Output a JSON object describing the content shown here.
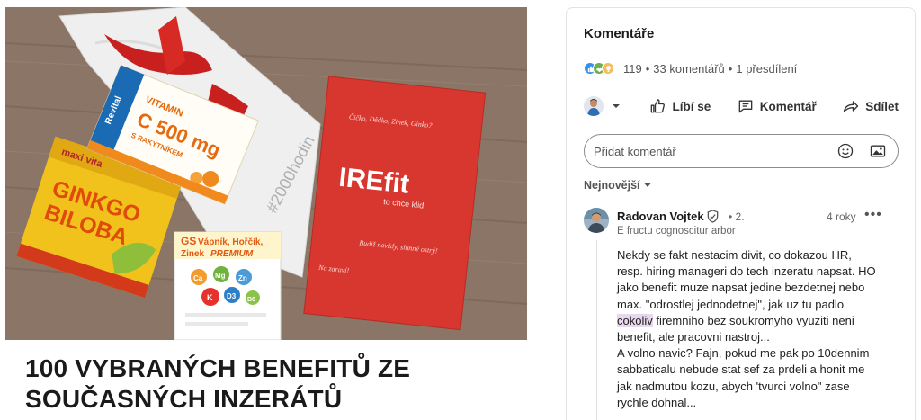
{
  "article": {
    "title_line1": "100 VYBRANÝCH BENEFITŮ ZE",
    "title_line2": "SOUČASNÝCH INZERÁTŮ",
    "image": {
      "alt": "",
      "box_vitamin": {
        "brand": "Revital",
        "line1": "VITAMIN",
        "line2": "C 500 mg",
        "line3": "S RAKYTNÍKEM"
      },
      "box_ginkgo": {
        "brand": "maxi vita",
        "line1": "GINKGO",
        "line2": "BILOBA"
      },
      "box_calcium": {
        "brand": "GS",
        "line1": "Vápník, Hořčík,",
        "line2": "Zinek",
        "line3": "PREMIUM",
        "minerals": [
          "Ca",
          "Mg",
          "Zn",
          "K",
          "D3",
          "B6"
        ]
      },
      "bag_text": "#2000hodin",
      "envelope": {
        "top_script": "Čičko, Dědko, Zinek, Ginko?",
        "logo": "IREfit",
        "tagline": "to chce klid",
        "bottom_script": "Budiž navždy, slunné ostrý!",
        "sign_script": "Na zdraví!"
      }
    }
  },
  "panel": {
    "title": "Komentáře",
    "reaction_count": "119",
    "comments_count": "33 komentářů",
    "separator": "•",
    "reposts": "1 přesdílení",
    "actions": {
      "like": "Líbí se",
      "comment": "Komentář",
      "share": "Sdílet"
    },
    "comment_input": {
      "placeholder": "Přidat komentář",
      "value": ""
    },
    "sort": "Nejnovější",
    "comment": {
      "author": "Radovan Vojtek",
      "degree": "• 2.",
      "time": "4 roky",
      "more": "•••",
      "headline": "E fructu cognoscitur arbor",
      "body_lines": [
        "Nekdy se fakt nestacim divit, co dokazou HR,",
        "resp. hiring manageri do tech inzeratu napsat. HO",
        "jako benefit muze napsat jedine bezdetnej nebo",
        "max. \"odrostlej jednodetnej\", jak uz tu padlo"
      ],
      "body_highlight": "cokoliv",
      "body_after_highlight": " firemniho bez soukromyho vyuziti neni",
      "body_lines_2": [
        "benefit, ale pracovni nastroj...",
        "A volno navic? Fajn, pokud me pak po 10dennim",
        "sabbaticalu nebude stat sef za prdeli a honit me",
        "jak nadmutou kozu, abych 'tvurci volno\" zase",
        "rychle dohnal..."
      ]
    }
  },
  "colors": {
    "envelope_red": "#d8372f",
    "wood": "#8a7464",
    "like_blue": "#378fe9",
    "support_green": "#6dae4f",
    "insight_yellow": "#f5bb5c",
    "highlight": "#e9d7f0"
  },
  "icons": [
    "like-reaction-icon",
    "support-reaction-icon",
    "insight-reaction-icon",
    "thumbs-up-icon",
    "comment-icon",
    "share-icon",
    "emoji-icon",
    "image-icon",
    "chevron-down-icon",
    "verified-icon",
    "avatar"
  ]
}
